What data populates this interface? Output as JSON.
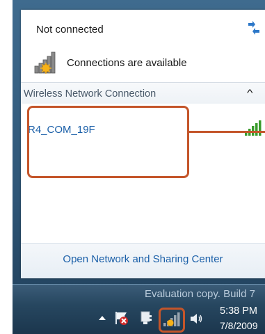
{
  "flyout": {
    "status": "Not connected",
    "availability": "Connections are available",
    "section_title": "Wireless Network Connection",
    "networks": [
      {
        "name": "R4_COM_19F"
      }
    ],
    "footer_link": "Open Network and Sharing Center"
  },
  "taskbar": {
    "watermark": "Evaluation copy. Build 7",
    "clock_time": "5:38 PM",
    "clock_date": "7/8/2009"
  },
  "colors": {
    "link": "#1a5fa8",
    "highlight": "#c4552a",
    "signal_green": "#3a9b2c"
  }
}
